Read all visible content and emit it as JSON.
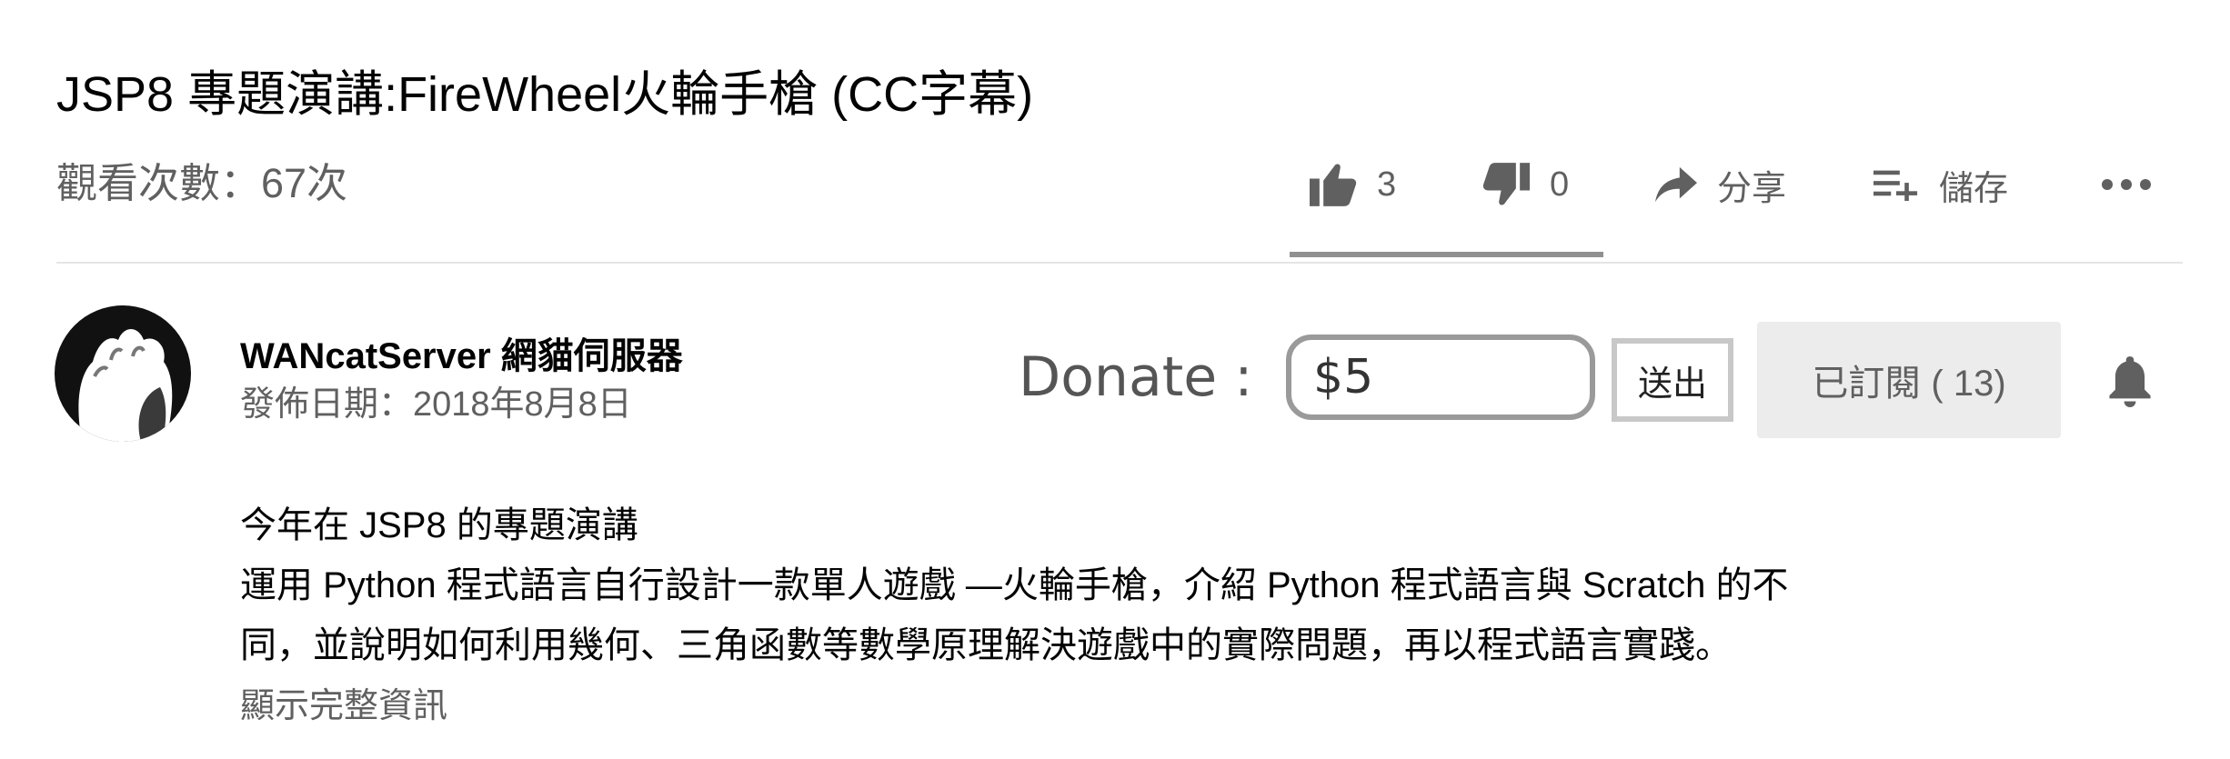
{
  "video": {
    "title": "JSP8 專題演講:FireWheel火輪手槍 (CC字幕)",
    "views": "觀看次數：67次"
  },
  "actions": {
    "like_count": "3",
    "dislike_count": "0",
    "share_label": "分享",
    "save_label": "儲存",
    "like_ratio": 1.0,
    "icons": [
      "thumb-up-icon",
      "thumb-down-icon",
      "share-arrow-icon",
      "playlist-add-icon",
      "more-horiz-icon"
    ]
  },
  "channel": {
    "name": "WANcatServer 網貓伺服器",
    "published": "發佈日期：2018年8月8日",
    "avatar_icon": "cat-paw-icon"
  },
  "donate": {
    "label": "Donate :",
    "value": "$5",
    "send_label": "送出"
  },
  "subscribe": {
    "label": "已訂閱 ( 13)",
    "bell_icon": "bell-icon"
  },
  "description": {
    "lines": [
      "今年在 JSP8 的專題演講",
      "運用 Python 程式語言自行設計一款單人遊戲 —火輪手槍，介紹 Python 程式語言與 Scratch 的不",
      "同，並說明如何利用幾何、三角函數等數學原理解決遊戲中的實際問題，再以程式語言實踐。"
    ],
    "show_more": "顯示完整資訊"
  },
  "colors": {
    "text_primary": "#030303",
    "text_secondary": "#606060",
    "subscribed_bg": "#ececec",
    "sentiment_bar": "#909090",
    "divider": "#e5e5e5"
  }
}
